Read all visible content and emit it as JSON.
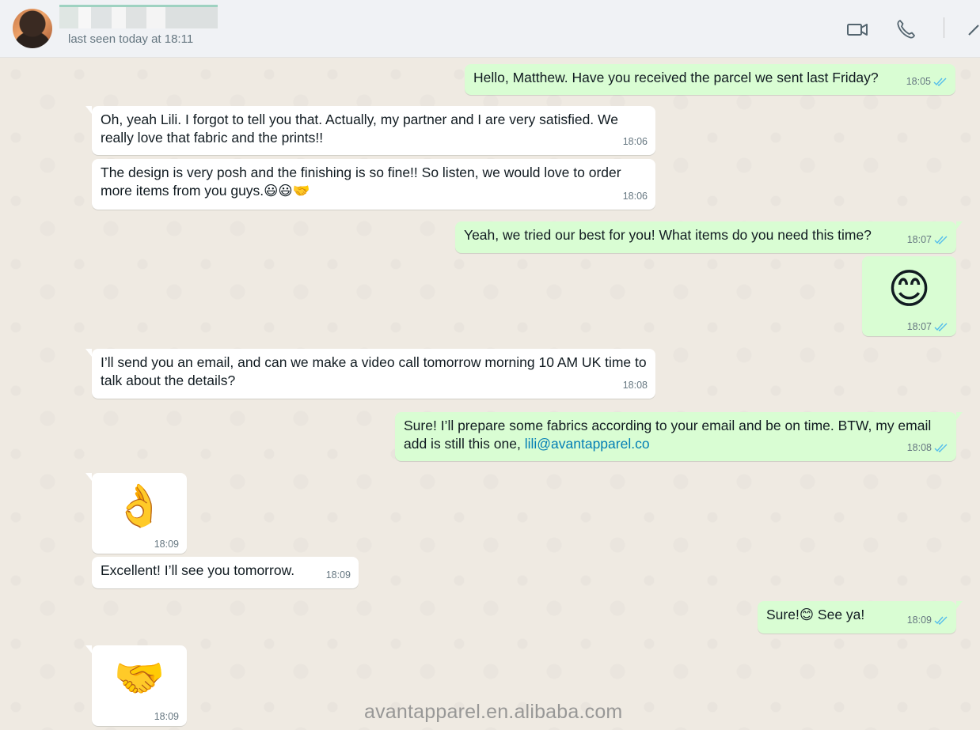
{
  "header": {
    "last_seen": "last seen today at 18:11",
    "icons": [
      "video-call-icon",
      "voice-call-icon"
    ]
  },
  "messages": [
    {
      "dir": "out",
      "text": "Hello, Matthew. Have you received the parcel we sent last Friday?",
      "time": "18:05",
      "read": true
    },
    {
      "dir": "in",
      "text": "Oh, yeah Lili. I forgot to tell you that. Actually, my partner and I are very satisfied. We really love that fabric and the prints!!",
      "time": "18:06"
    },
    {
      "dir": "in",
      "text": "The design is very posh and the finishing is so fine!! So listen, we would love to order more items from you guys.😃😃🤝",
      "time": "18:06"
    },
    {
      "dir": "out",
      "text": "Yeah, we tried our best for you! What items do you need this time?",
      "time": "18:07",
      "read": true
    },
    {
      "dir": "out",
      "text": "😊",
      "time": "18:07",
      "read": true
    },
    {
      "dir": "in",
      "text": "I’ll send you an email, and can we make a video call tomorrow morning 10 AM UK time to talk about the details?",
      "time": "18:08"
    },
    {
      "dir": "out",
      "text": "Sure! I’ll prepare some fabrics according to your email and be on time. BTW, my email add is still this one, ",
      "link": "lili@avantapparel.co",
      "time": "18:08",
      "read": true
    },
    {
      "dir": "in",
      "text": "👌",
      "time": "18:09"
    },
    {
      "dir": "in",
      "text": "Excellent! I’ll see you tomorrow.",
      "time": "18:09"
    },
    {
      "dir": "out",
      "text": "Sure!😊 See ya!",
      "time": "18:09",
      "read": true
    },
    {
      "dir": "in",
      "text": "🤝",
      "time": "18:09"
    }
  ],
  "watermark": "avantapparel.en.alibaba.com",
  "colors": {
    "incoming": "#ffffff",
    "outgoing": "#d9fdd3",
    "read_tick": "#53bdeb",
    "link": "#027eb5"
  }
}
